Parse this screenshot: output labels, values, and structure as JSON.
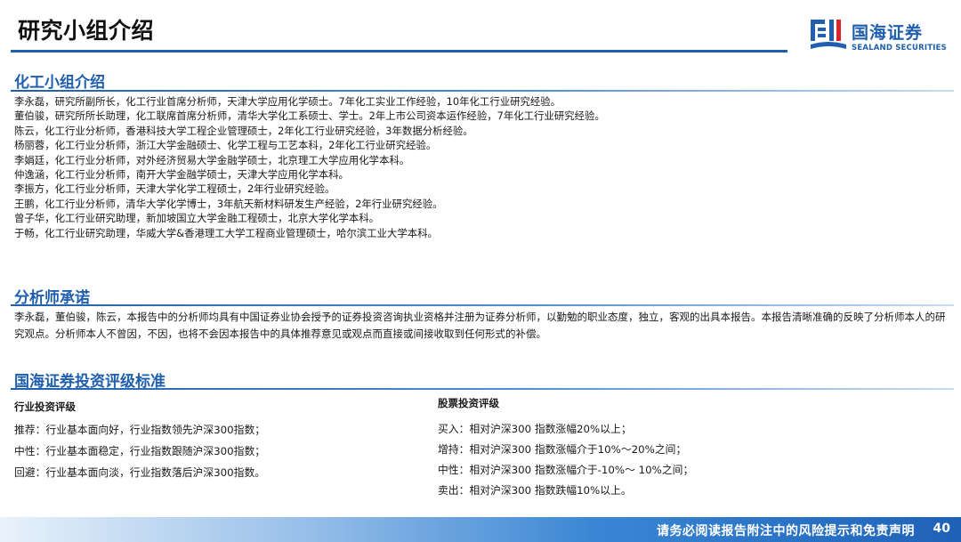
{
  "page": {
    "title": "研究小组介绍"
  },
  "brand": {
    "logo_name": "国海证券",
    "logo_sub": "SEALAND SECURITIES",
    "color": "#1f5fae"
  },
  "team_section": {
    "title": "化工小组介绍",
    "members": [
      "李永磊，研究所副所长，化工行业首席分析师，天津大学应用化学硕士。7年化工实业工作经验，10年化工行业研究经验。",
      "董伯骏，研究所所长助理，化工联席首席分析师，清华大学化工系硕士、学士。2年上市公司资本运作经验，7年化工行业研究经验。",
      "陈云，化工行业分析师，香港科技大学工程企业管理硕士，2年化工行业研究经验，3年数据分析经验。",
      "杨丽蓉，化工行业分析师，浙江大学金融硕士、化学工程与工艺本科，2年化工行业研究经验。",
      "李娟廷，化工行业分析师，对外经济贸易大学金融学硕士，北京理工大学应用化学本科。",
      "仲逸涵，化工行业分析师，南开大学金融学硕士，天津大学应用化学本科。",
      "李振方，化工行业分析师，天津大学化学工程硕士，2年行业研究经验。",
      "王鹏，化工行业分析师，清华大学化学博士，3年航天新材料研发生产经验，2年行业研究经验。",
      "曾子华，化工行业研究助理，新加坡国立大学金融工程硕士，北京大学化学本科。",
      "于畅，化工行业研究助理，华威大学&香港理工大学工程商业管理硕士，哈尔滨工业大学本科。"
    ]
  },
  "commitment_section": {
    "title": "分析师承诺",
    "text": "李永磊，董伯骏，陈云，本报告中的分析师均具有中国证券业协会授予的证券投资咨询执业资格并注册为证券分析师，以勤勉的职业态度，独立，客观的出具本报告。本报告清晰准确的反映了分析师本人的研究观点。分析师本人不曾因，不因，也将不会因本报告中的具体推荐意见或观点而直接或间接收取到任何形式的补偿。"
  },
  "rating_section": {
    "title": "国海证券投资评级标准",
    "industry": {
      "heading": "行业投资评级",
      "items": [
        "推荐：行业基本面向好，行业指数领先沪深300指数；",
        "中性：行业基本面稳定，行业指数跟随沪深300指数；",
        "回避：行业基本面向淡，行业指数落后沪深300指数。"
      ]
    },
    "stock": {
      "heading": "股票投资评级",
      "items": [
        "买入：相对沪深300 指数涨幅20%以上；",
        "增持：相对沪深300 指数涨幅介于10%～20%之间；",
        "中性：相对沪深300 指数涨幅介于-10%～ 10%之间；",
        "卖出：相对沪深300 指数跌幅10%以上。"
      ]
    }
  },
  "footer": {
    "disclaimer": "请务必阅读报告附注中的风险提示和免责声明",
    "page_number": "40"
  }
}
